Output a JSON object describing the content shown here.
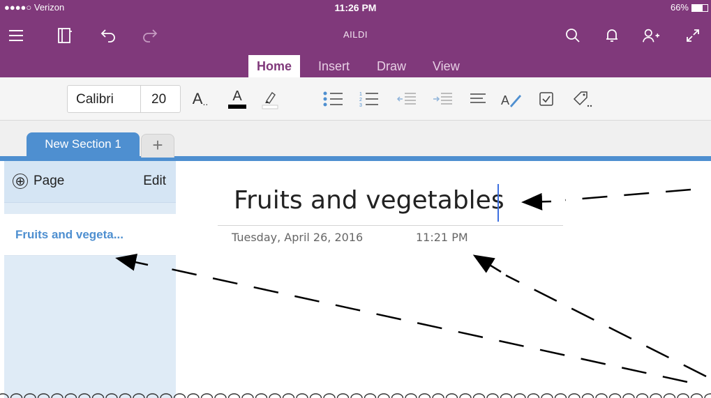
{
  "status_bar": {
    "carrier": "●●●●○ Verizon",
    "time": "11:26 PM",
    "battery": "66%",
    "battery_level": 0.66
  },
  "app_bar": {
    "notebook_title": "AILDI",
    "icons_left": [
      "menu-icon",
      "notebook-icon",
      "undo-icon",
      "redo-icon"
    ],
    "icons_right": [
      "search-icon",
      "bell-icon",
      "share-user-icon",
      "expand-icon"
    ]
  },
  "ribbon_tabs": [
    {
      "label": "Home",
      "active": true
    },
    {
      "label": "Insert",
      "active": false
    },
    {
      "label": "Draw",
      "active": false
    },
    {
      "label": "View",
      "active": false
    }
  ],
  "ribbon": {
    "font_name": "Calibri",
    "font_size": "20",
    "tools": [
      "text-styles-icon",
      "font-color-icon",
      "highlighter-icon",
      "bullet-list-icon",
      "numbered-list-icon",
      "outdent-icon",
      "indent-icon",
      "align-icon",
      "format-painter-icon",
      "checkbox-tag-icon",
      "tag-icon"
    ],
    "styles_label": "A",
    "font_color_label": "A"
  },
  "sections": {
    "active_label": "New Section 1",
    "add_label": "+"
  },
  "pages_panel": {
    "add_page_icon": "⊕",
    "add_page_label": "Page",
    "edit_label": "Edit",
    "items": [
      {
        "label": "Fruits and vegeta...",
        "selected": true
      }
    ]
  },
  "note": {
    "title": "Fruits and vegetables",
    "date": "Tuesday, April 26, 2016",
    "time": "11:21 PM"
  },
  "colors": {
    "brand_purple": "#80397b",
    "section_blue": "#4e8fd0",
    "panel_blue": "#dfebf6"
  }
}
